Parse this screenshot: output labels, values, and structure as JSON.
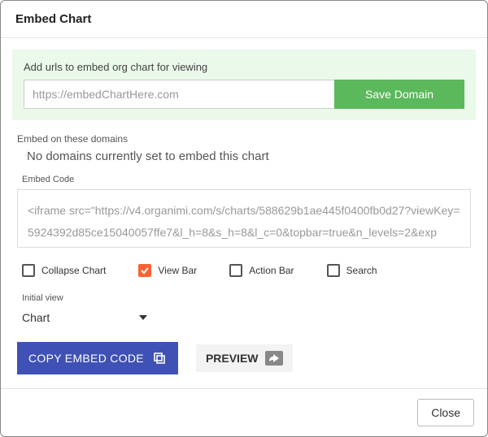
{
  "header": {
    "title": "Embed Chart"
  },
  "urlSection": {
    "label": "Add urls to embed org chart for viewing",
    "placeholder": "https://embedChartHere.com",
    "saveLabel": "Save Domain"
  },
  "domains": {
    "label": "Embed on these domains",
    "empty": "No domains currently set to embed this chart"
  },
  "embed": {
    "label": "Embed Code",
    "code": "<iframe src=\"https://v4.organimi.com/s/charts/588629b1ae445f0400fb0d27?viewKey=5924392d85ce15040057ffe7&l_h=8&s_h=8&l_c=0&topbar=true&n_levels=2&exp"
  },
  "options": {
    "collapse": {
      "label": "Collapse Chart",
      "checked": false
    },
    "viewBar": {
      "label": "View Bar",
      "checked": true
    },
    "actionBar": {
      "label": "Action Bar",
      "checked": false
    },
    "search": {
      "label": "Search",
      "checked": false
    }
  },
  "initialView": {
    "label": "Initial view",
    "value": "Chart"
  },
  "actions": {
    "copy": "COPY EMBED CODE",
    "preview": "PREVIEW"
  },
  "footer": {
    "close": "Close"
  }
}
